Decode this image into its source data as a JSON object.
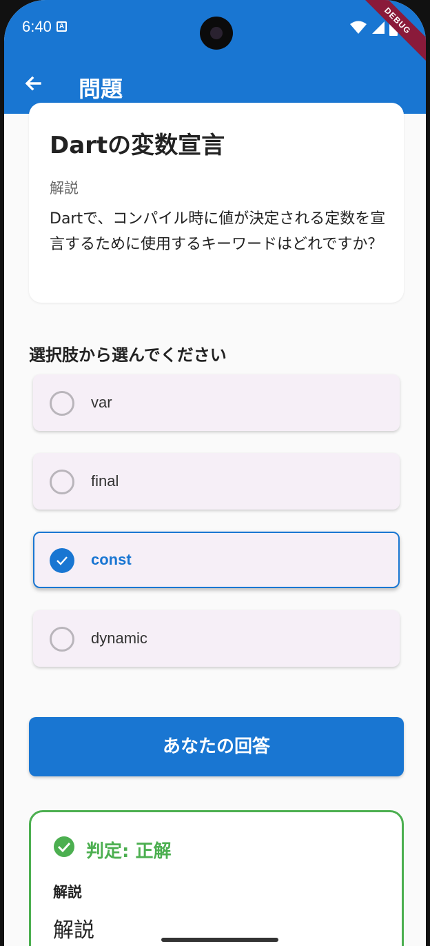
{
  "status_bar": {
    "time": "6:40",
    "notification_glyph": "A",
    "icons": [
      "wifi-icon",
      "cell-signal-icon",
      "battery-icon"
    ]
  },
  "debug_banner": "DEBUG",
  "app_bar": {
    "title": "問題",
    "back_icon": "arrow-back-icon",
    "color": "#1976d2"
  },
  "question": {
    "title": "Dartの変数宣言",
    "subtitle": "解説",
    "body": "Dartで、コンパイル時に値が決定される定数を宣言するために使用するキーワードはどれですか？"
  },
  "choices_label": "選択肢から選んでください",
  "options": [
    {
      "label": "var",
      "selected": false
    },
    {
      "label": "final",
      "selected": false
    },
    {
      "label": "const",
      "selected": true
    },
    {
      "label": "dynamic",
      "selected": false
    }
  ],
  "answer_button": {
    "label": "あなたの回答"
  },
  "result": {
    "title": "判定: 正解",
    "icon": "check-circle-icon",
    "color": "#4caf50",
    "subtitle": "解説",
    "body": "解説"
  }
}
